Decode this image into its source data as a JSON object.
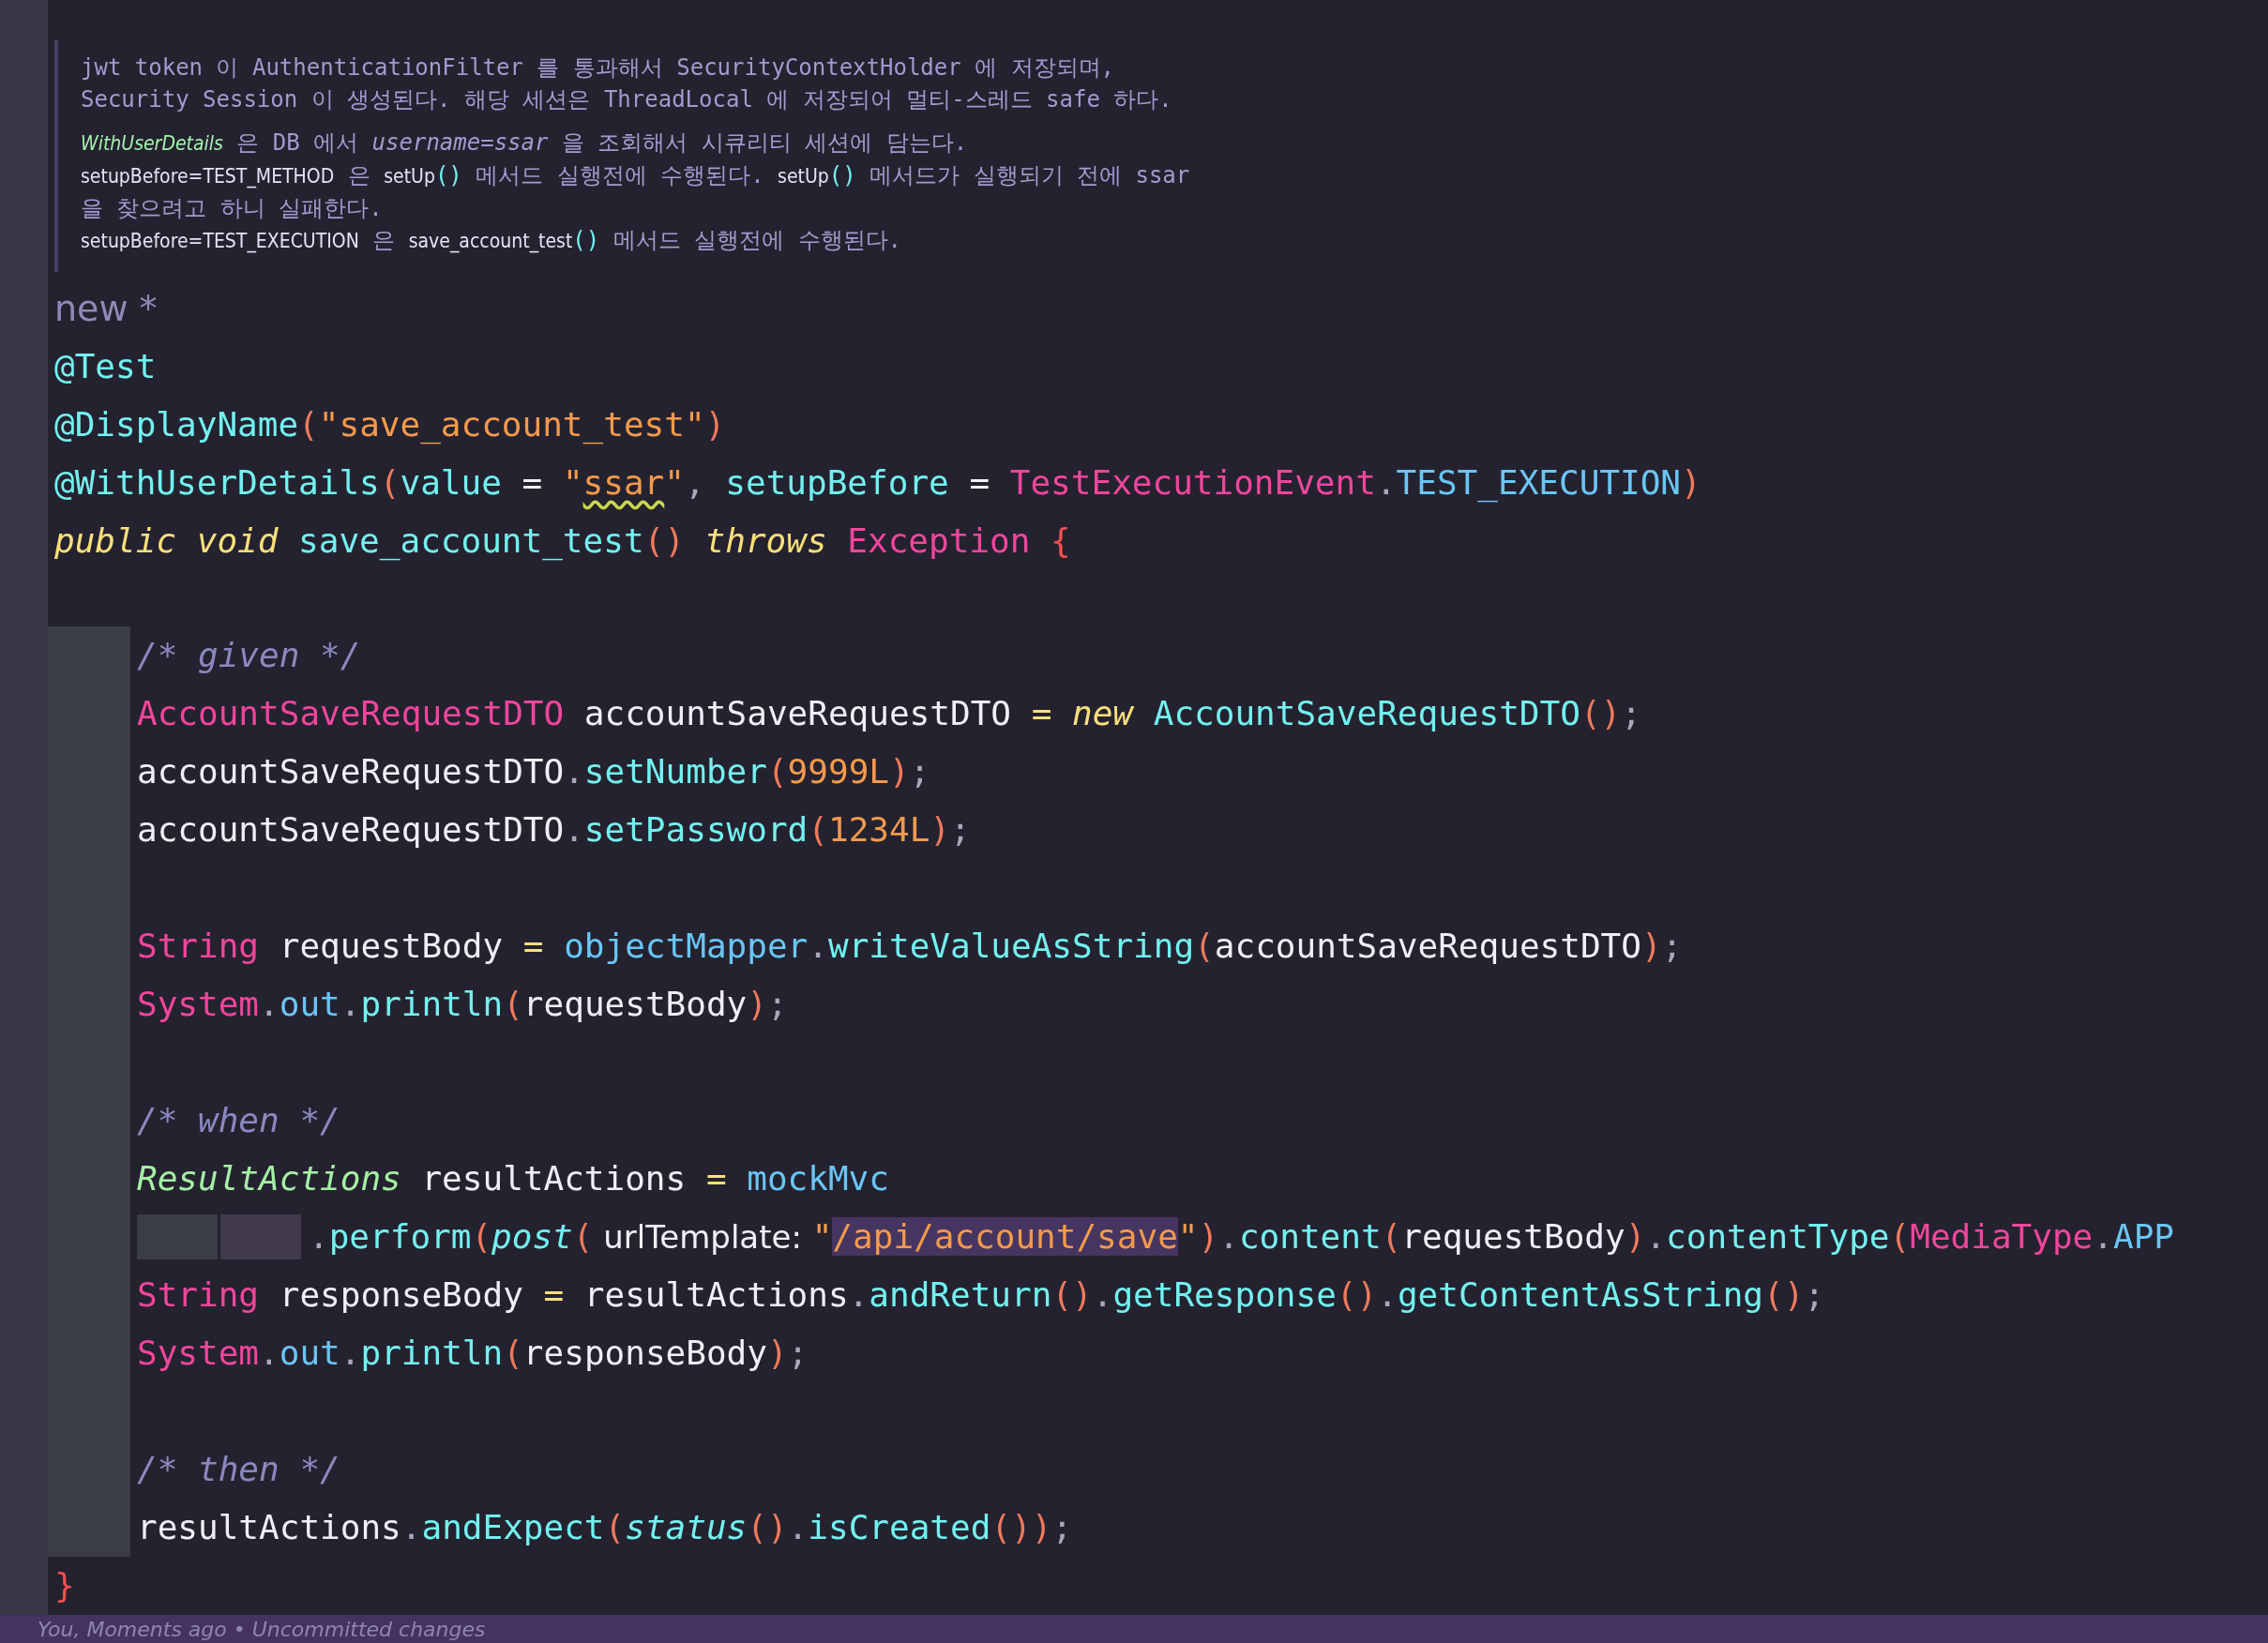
{
  "doc_comment": {
    "paragraphs": [
      {
        "lines": [
          [
            {
              "text": "jwt token 이 AuthenticationFilter 를 통과해서 SecurityContextHolder 에 저장되며,",
              "kind": "text"
            }
          ],
          [
            {
              "text": "Security Session 이 생성된다. 해당 세션은 ThreadLocal 에 저장되어 멀티-스레드 safe 하다.",
              "kind": "text"
            }
          ]
        ]
      },
      {
        "lines": [
          [
            {
              "text": "WithUserDetails",
              "kind": "ref"
            },
            {
              "text": " 은 DB 에서 ",
              "kind": "text"
            },
            {
              "text": "username=ssar",
              "kind": "param"
            },
            {
              "text": " 을 조회해서 시큐리티 세션에 담는다.",
              "kind": "text"
            }
          ],
          [
            {
              "text": "setupBefore=TEST_METHOD",
              "kind": "code"
            },
            {
              "text": " 은 ",
              "kind": "text"
            },
            {
              "text": "setUp",
              "kind": "code"
            },
            {
              "text": "()",
              "kind": "paren"
            },
            {
              "text": " 메서드 실행전에 수행된다. ",
              "kind": "text"
            },
            {
              "text": "setUp",
              "kind": "code"
            },
            {
              "text": "()",
              "kind": "paren"
            },
            {
              "text": " 메서드가 실행되기 전에 ssar",
              "kind": "text"
            }
          ],
          [
            {
              "text": "을 찾으려고 하니 실패한다.",
              "kind": "text"
            }
          ],
          [
            {
              "text": "setupBefore=TEST_EXECUTION",
              "kind": "code"
            },
            {
              "text": " 은 ",
              "kind": "text"
            },
            {
              "text": "save_account_test",
              "kind": "code"
            },
            {
              "text": "()",
              "kind": "paren"
            },
            {
              "text": " 메서드 실행전에 수행된다.",
              "kind": "text"
            }
          ]
        ]
      }
    ]
  },
  "code": {
    "author_hint": "new *",
    "header": [
      {
        "kind": "code",
        "tokens": [
          {
            "text": "@Test",
            "kind": "annotation"
          }
        ]
      },
      {
        "kind": "code",
        "tokens": [
          {
            "text": "@DisplayName",
            "kind": "annotation"
          },
          {
            "text": "(",
            "kind": "paren"
          },
          {
            "text": "\"save_account_test\"",
            "kind": "string"
          },
          {
            "text": ")",
            "kind": "paren"
          }
        ]
      },
      {
        "kind": "code",
        "tokens": [
          {
            "text": "@WithUserDetails",
            "kind": "annotation"
          },
          {
            "text": "(",
            "kind": "paren"
          },
          {
            "text": "value",
            "kind": "func"
          },
          {
            "text": " = ",
            "kind": "plain"
          },
          {
            "text": "\"",
            "kind": "string"
          },
          {
            "text": "ssar",
            "kind": "string-warning"
          },
          {
            "text": "\"",
            "kind": "string"
          },
          {
            "text": ", ",
            "kind": "punct"
          },
          {
            "text": "setupBefore",
            "kind": "func"
          },
          {
            "text": " = ",
            "kind": "plain"
          },
          {
            "text": "TestExecutionEvent",
            "kind": "type"
          },
          {
            "text": ".",
            "kind": "punct"
          },
          {
            "text": "TEST_EXECUTION",
            "kind": "field"
          },
          {
            "text": ")",
            "kind": "paren"
          }
        ]
      },
      {
        "kind": "code",
        "tokens": [
          {
            "text": "public void ",
            "kind": "keyword"
          },
          {
            "text": "save_account_test",
            "kind": "func"
          },
          {
            "text": "() ",
            "kind": "paren"
          },
          {
            "text": "throws ",
            "kind": "keyword"
          },
          {
            "text": "Exception ",
            "kind": "type"
          },
          {
            "text": "{",
            "kind": "brace"
          }
        ]
      },
      {
        "kind": "blank"
      }
    ],
    "body": [
      {
        "kind": "code",
        "tokens": [
          {
            "text": "/* given */",
            "kind": "comment"
          }
        ]
      },
      {
        "kind": "code",
        "tokens": [
          {
            "text": "AccountSaveRequestDTO",
            "kind": "type"
          },
          {
            "text": " accountSaveRequestDTO ",
            "kind": "plain"
          },
          {
            "text": "=",
            "kind": "op"
          },
          {
            "text": " new ",
            "kind": "keyword"
          },
          {
            "text": "AccountSaveRequestDTO",
            "kind": "func"
          },
          {
            "text": "()",
            "kind": "paren"
          },
          {
            "text": ";",
            "kind": "punct"
          }
        ]
      },
      {
        "kind": "code",
        "tokens": [
          {
            "text": "accountSaveRequestDTO",
            "kind": "plain"
          },
          {
            "text": ".",
            "kind": "punct"
          },
          {
            "text": "setNumber",
            "kind": "func"
          },
          {
            "text": "(",
            "kind": "paren"
          },
          {
            "text": "9999L",
            "kind": "num"
          },
          {
            "text": ")",
            "kind": "paren"
          },
          {
            "text": ";",
            "kind": "punct"
          }
        ]
      },
      {
        "kind": "code",
        "tokens": [
          {
            "text": "accountSaveRequestDTO",
            "kind": "plain"
          },
          {
            "text": ".",
            "kind": "punct"
          },
          {
            "text": "setPassword",
            "kind": "func"
          },
          {
            "text": "(",
            "kind": "paren"
          },
          {
            "text": "1234L",
            "kind": "num"
          },
          {
            "text": ")",
            "kind": "paren"
          },
          {
            "text": ";",
            "kind": "punct"
          }
        ]
      },
      {
        "kind": "blank"
      },
      {
        "kind": "code",
        "tokens": [
          {
            "text": "String",
            "kind": "type"
          },
          {
            "text": " requestBody ",
            "kind": "plain"
          },
          {
            "text": "=",
            "kind": "op"
          },
          {
            "text": " objectMapper",
            "kind": "field"
          },
          {
            "text": ".",
            "kind": "punct"
          },
          {
            "text": "writeValueAsString",
            "kind": "func"
          },
          {
            "text": "(",
            "kind": "paren"
          },
          {
            "text": "accountSaveRequestDTO",
            "kind": "plain"
          },
          {
            "text": ")",
            "kind": "paren"
          },
          {
            "text": ";",
            "kind": "punct"
          }
        ]
      },
      {
        "kind": "code",
        "tokens": [
          {
            "text": "System",
            "kind": "type"
          },
          {
            "text": ".",
            "kind": "punct"
          },
          {
            "text": "out",
            "kind": "field"
          },
          {
            "text": ".",
            "kind": "punct"
          },
          {
            "text": "println",
            "kind": "func"
          },
          {
            "text": "(",
            "kind": "paren"
          },
          {
            "text": "requestBody",
            "kind": "plain"
          },
          {
            "text": ")",
            "kind": "paren"
          },
          {
            "text": ";",
            "kind": "punct"
          }
        ]
      },
      {
        "kind": "blank"
      },
      {
        "kind": "code",
        "tokens": [
          {
            "text": "/* when */",
            "kind": "comment"
          }
        ]
      },
      {
        "kind": "code",
        "tokens": [
          {
            "text": "ResultActions",
            "kind": "class"
          },
          {
            "text": " resultActions ",
            "kind": "plain"
          },
          {
            "text": "=",
            "kind": "op"
          },
          {
            "text": " mockMvc",
            "kind": "field"
          }
        ]
      },
      {
        "kind": "continuation",
        "tokens": [
          {
            "text": ".",
            "kind": "punct"
          },
          {
            "text": "perform",
            "kind": "func"
          },
          {
            "text": "(",
            "kind": "paren"
          },
          {
            "text": "post",
            "kind": "italic-func"
          },
          {
            "text": "(",
            "kind": "paren"
          },
          {
            "text": " urlTemplate: ",
            "kind": "hint"
          },
          {
            "text": "\"",
            "kind": "string"
          },
          {
            "text": "/api/account/save",
            "kind": "string-highlight"
          },
          {
            "text": "\"",
            "kind": "string"
          },
          {
            "text": ")",
            "kind": "paren"
          },
          {
            "text": ".",
            "kind": "punct"
          },
          {
            "text": "content",
            "kind": "func"
          },
          {
            "text": "(",
            "kind": "paren"
          },
          {
            "text": "requestBody",
            "kind": "plain"
          },
          {
            "text": ")",
            "kind": "paren"
          },
          {
            "text": ".",
            "kind": "punct"
          },
          {
            "text": "contentType",
            "kind": "func"
          },
          {
            "text": "(",
            "kind": "paren"
          },
          {
            "text": "MediaType",
            "kind": "type"
          },
          {
            "text": ".",
            "kind": "punct"
          },
          {
            "text": "APP",
            "kind": "field"
          }
        ]
      },
      {
        "kind": "code",
        "tokens": [
          {
            "text": "String",
            "kind": "type"
          },
          {
            "text": " responseBody ",
            "kind": "plain"
          },
          {
            "text": "=",
            "kind": "op"
          },
          {
            "text": " resultActions",
            "kind": "plain"
          },
          {
            "text": ".",
            "kind": "punct"
          },
          {
            "text": "andReturn",
            "kind": "func"
          },
          {
            "text": "()",
            "kind": "paren"
          },
          {
            "text": ".",
            "kind": "punct"
          },
          {
            "text": "getResponse",
            "kind": "func"
          },
          {
            "text": "()",
            "kind": "paren"
          },
          {
            "text": ".",
            "kind": "punct"
          },
          {
            "text": "getContentAsString",
            "kind": "func"
          },
          {
            "text": "()",
            "kind": "paren"
          },
          {
            "text": ";",
            "kind": "punct"
          }
        ]
      },
      {
        "kind": "code",
        "tokens": [
          {
            "text": "System",
            "kind": "type"
          },
          {
            "text": ".",
            "kind": "punct"
          },
          {
            "text": "out",
            "kind": "field"
          },
          {
            "text": ".",
            "kind": "punct"
          },
          {
            "text": "println",
            "kind": "func"
          },
          {
            "text": "(",
            "kind": "paren"
          },
          {
            "text": "responseBody",
            "kind": "plain"
          },
          {
            "text": ")",
            "kind": "paren"
          },
          {
            "text": ";",
            "kind": "punct"
          }
        ]
      },
      {
        "kind": "blank"
      },
      {
        "kind": "code",
        "tokens": [
          {
            "text": "/* then */",
            "kind": "comment"
          }
        ]
      },
      {
        "kind": "code",
        "tokens": [
          {
            "text": "resultActions",
            "kind": "plain"
          },
          {
            "text": ".",
            "kind": "punct"
          },
          {
            "text": "andExpect",
            "kind": "func"
          },
          {
            "text": "(",
            "kind": "paren"
          },
          {
            "text": "status",
            "kind": "italic-func"
          },
          {
            "text": "()",
            "kind": "paren"
          },
          {
            "text": ".",
            "kind": "punct"
          },
          {
            "text": "isCreated",
            "kind": "func"
          },
          {
            "text": "())",
            "kind": "paren"
          },
          {
            "text": ";",
            "kind": "punct"
          }
        ]
      }
    ],
    "footer": [
      {
        "kind": "code",
        "tokens": [
          {
            "text": "}",
            "kind": "brace"
          }
        ]
      }
    ]
  },
  "blame_bar": "You, Moments ago • Uncommitted changes"
}
